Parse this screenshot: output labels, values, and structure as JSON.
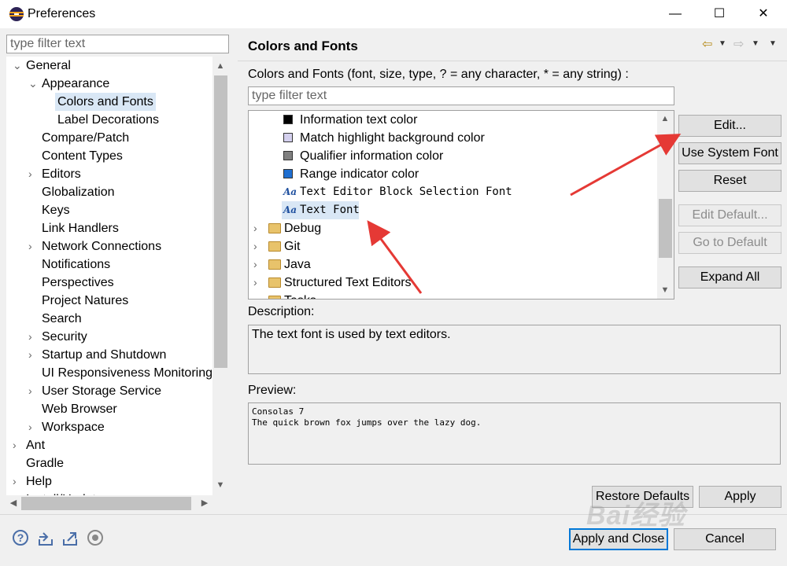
{
  "window": {
    "title": "Preferences",
    "minimize": "—",
    "maximize": "☐",
    "close": "✕"
  },
  "left": {
    "filter_placeholder": "type filter text",
    "tree": [
      {
        "label": "General",
        "twisty": "v"
      },
      {
        "label": "Appearance",
        "twisty": "v"
      },
      {
        "label": "Colors and Fonts",
        "twisty": "",
        "selected": true
      },
      {
        "label": "Label Decorations",
        "twisty": ""
      },
      {
        "label": "Compare/Patch",
        "twisty": ""
      },
      {
        "label": "Content Types",
        "twisty": ""
      },
      {
        "label": "Editors",
        "twisty": ">"
      },
      {
        "label": "Globalization",
        "twisty": ""
      },
      {
        "label": "Keys",
        "twisty": ""
      },
      {
        "label": "Link Handlers",
        "twisty": ""
      },
      {
        "label": "Network Connections",
        "twisty": ">"
      },
      {
        "label": "Notifications",
        "twisty": ""
      },
      {
        "label": "Perspectives",
        "twisty": ""
      },
      {
        "label": "Project Natures",
        "twisty": ""
      },
      {
        "label": "Search",
        "twisty": ""
      },
      {
        "label": "Security",
        "twisty": ">"
      },
      {
        "label": "Startup and Shutdown",
        "twisty": ">"
      },
      {
        "label": "UI Responsiveness Monitoring",
        "twisty": ""
      },
      {
        "label": "User Storage Service",
        "twisty": ">"
      },
      {
        "label": "Web Browser",
        "twisty": ""
      },
      {
        "label": "Workspace",
        "twisty": ">"
      },
      {
        "label": "Ant",
        "twisty": ">"
      },
      {
        "label": "Gradle",
        "twisty": ""
      },
      {
        "label": "Help",
        "twisty": ">"
      },
      {
        "label": "Install/Update",
        "twisty": ">"
      }
    ]
  },
  "page": {
    "title": "Colors and Fonts",
    "description": "Colors and Fonts (font, size, type, ? = any character, * = any string) :",
    "filter_placeholder": "type filter text",
    "items": [
      {
        "label": "Information text color",
        "kind": "color",
        "color": "#000000"
      },
      {
        "label": "Match highlight background color",
        "kind": "color",
        "color": "#d4d0ee"
      },
      {
        "label": "Qualifier information color",
        "kind": "color",
        "color": "#808080"
      },
      {
        "label": "Range indicator color",
        "kind": "color",
        "color": "#1f6fd1"
      },
      {
        "label": "Text Editor Block Selection Font",
        "kind": "font"
      },
      {
        "label": "Text Font",
        "kind": "font",
        "selected": true
      },
      {
        "label": "Debug",
        "kind": "category"
      },
      {
        "label": "Git",
        "kind": "category"
      },
      {
        "label": "Java",
        "kind": "category"
      },
      {
        "label": "Structured Text Editors",
        "kind": "category"
      },
      {
        "label": "Tasks",
        "kind": "category"
      }
    ],
    "font_icon": "Aa",
    "buttons": {
      "edit": "Edit...",
      "use_system_font": "Use System Font",
      "reset": "Reset",
      "edit_default": "Edit Default...",
      "go_to_default": "Go to Default",
      "expand_all": "Expand All"
    },
    "description_label": "Description:",
    "description_text": "The text font is used by text editors.",
    "preview_label": "Preview:",
    "preview_lines": [
      "Consolas 7",
      "The quick brown fox jumps over the lazy dog."
    ]
  },
  "footer": {
    "restore_defaults": "Restore Defaults",
    "apply": "Apply",
    "apply_and_close": "Apply and Close",
    "cancel": "Cancel"
  },
  "icons": [
    "help-icon",
    "import-icon",
    "export-icon",
    "record-icon",
    "back-icon",
    "forward-icon"
  ],
  "annotation_color": "#e53935",
  "watermark": "Bai经验"
}
